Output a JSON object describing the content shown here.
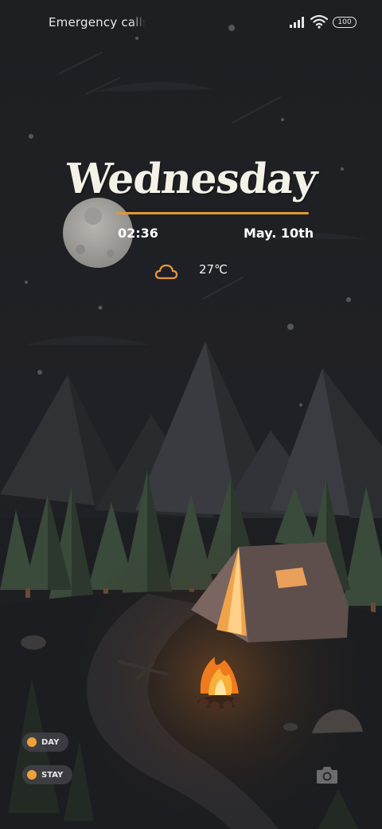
{
  "status_bar": {
    "carrier_text": "Emergency calls only",
    "battery": "100",
    "signal_icon": "signal-bars-icon",
    "wifi_icon": "wifi-icon"
  },
  "clock_widget": {
    "day": "Wednesday",
    "time": "02:36",
    "date": "May. 10th",
    "weather_icon": "cloud-icon",
    "temperature": "27℃",
    "accent_color": "#e2963a"
  },
  "chips": [
    {
      "label": "DAY"
    },
    {
      "label": "STAY"
    }
  ],
  "camera": {
    "icon": "camera-icon"
  },
  "colors": {
    "sky": "#1f2024",
    "fire": "#f29a2e",
    "tent": "#6b5a55"
  }
}
